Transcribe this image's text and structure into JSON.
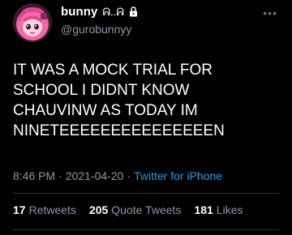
{
  "user": {
    "display_name": "bunny",
    "name_glyph": "ᕱ..ᕱ",
    "handle": "@gurobunnyy",
    "avatar_icon": "avatar-illustration-pink-hair",
    "verified_icon": "lock-icon"
  },
  "tweet": {
    "text": "IT WAS A MOCK TRIAL FOR\nSCHOOL I DIDNT KNOW\nCHAUVINW AS TODAY IM\nNINETEEEEEEEEEEEEEEEN"
  },
  "meta": {
    "time": "8:46 PM",
    "sep1": "·",
    "date": "2021-04-20",
    "sep2": "·",
    "source": "Twitter for iPhone"
  },
  "stats": {
    "retweets_count": "17",
    "retweets_label": "Retweets",
    "quote_count": "205",
    "quote_label": "Quote Tweets",
    "likes_count": "181",
    "likes_label": "Likes"
  },
  "colors": {
    "background": "#000000",
    "text": "#ffffff",
    "secondary": "#8b98a5",
    "accent": "#1d9bf0"
  }
}
